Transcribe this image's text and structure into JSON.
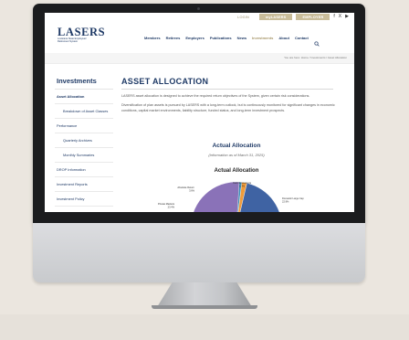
{
  "utility": {
    "login": "LOGIN",
    "mylasers": "myLASERS",
    "employer": "EMPLOYER",
    "social": [
      "f",
      "X",
      "▶"
    ]
  },
  "logo": {
    "wordmark": "LASERS",
    "subtitle": "Louisiana State Employees' Retirement System"
  },
  "nav": {
    "items": [
      "Members",
      "Retirees",
      "Employers",
      "Publications",
      "News",
      "Investments",
      "About",
      "Contact"
    ],
    "active": "Investments"
  },
  "breadcrumb": "You are here: Home / Investments / Asset Allocation",
  "sidebar": {
    "title": "Investments",
    "items": [
      {
        "label": "Asset Allocation",
        "active": true,
        "sub": false
      },
      {
        "label": "Breakdown of Asset Classes",
        "active": false,
        "sub": true
      },
      {
        "label": "Performance",
        "active": false,
        "sub": false
      },
      {
        "label": "Quarterly Archives",
        "active": false,
        "sub": true
      },
      {
        "label": "Monthly Summaries",
        "active": false,
        "sub": true
      },
      {
        "label": "DROP Information",
        "active": false,
        "sub": false
      },
      {
        "label": "Investment Reports",
        "active": false,
        "sub": false
      },
      {
        "label": "Investment Policy",
        "active": false,
        "sub": false
      }
    ]
  },
  "main": {
    "title": "ASSET ALLOCATION",
    "paragraph1": "LASERS asset allocation is designed to achieve the required return objectives of the System, given certain risk considerations.",
    "paragraph2": "Diversification of plan assets is pursued by LASERS with a long-term outlook, but is continuously monitored for significant changes in economic conditions, capital market environments, liability structure, funded status, and long-term investment prospects.",
    "chart_heading": "Actual Allocation",
    "chart_subheading": "(Information as of March 31, 2025)",
    "chart_title": "Actual Allocation"
  },
  "colors": {
    "navy": "#1f3a66",
    "gold": "#c9bd9a",
    "purple": "#8a72b8",
    "blue": "#3f63a3",
    "orange": "#ef9b3a",
    "teal": "#3e8fb8"
  },
  "chart_data": {
    "type": "pie",
    "title": "Actual Allocation",
    "slices": [
      {
        "name": "Cash Equivalents",
        "value": 1.3,
        "label": "1.3%",
        "color": "#ef9b3a"
      },
      {
        "name": "Domestic Large Cap",
        "value": 22.9,
        "label": "22.9%",
        "color": "#3f63a3"
      },
      {
        "name": "Private Markets",
        "value": 23.4,
        "label": "23.4%",
        "color": "#8a72b8"
      },
      {
        "name": "Absolute Return",
        "value": 3.6,
        "label": "3.6%",
        "color": "#3e8fb8"
      }
    ]
  }
}
